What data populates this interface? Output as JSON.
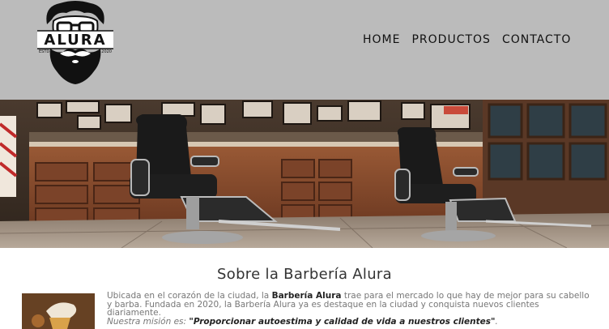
{
  "header": {
    "logo": {
      "brand": "ALURA",
      "estd": "ESTD",
      "year": "2020"
    },
    "nav": [
      {
        "label": "HOME"
      },
      {
        "label": "PRODUCTOS"
      },
      {
        "label": "CONTACTO"
      }
    ]
  },
  "about": {
    "title": "Sobre la Barbería Alura",
    "paragraph": {
      "part1": "Ubicada en el corazón de la ciudad, la ",
      "brand": "Barbería Alura",
      "part2": " trae para el mercado lo que hay de mejor para su cabello y barba. Fundada en 2020, la Barbería Alura ya es destaque en la ciudad y conquista nuevos clientes diariamente."
    },
    "mission": {
      "label": "Nuestra misión es: ",
      "quote": "\"Proporcionar autoestima y calidad de vida a nuestros clientes\"",
      "end": "."
    }
  }
}
